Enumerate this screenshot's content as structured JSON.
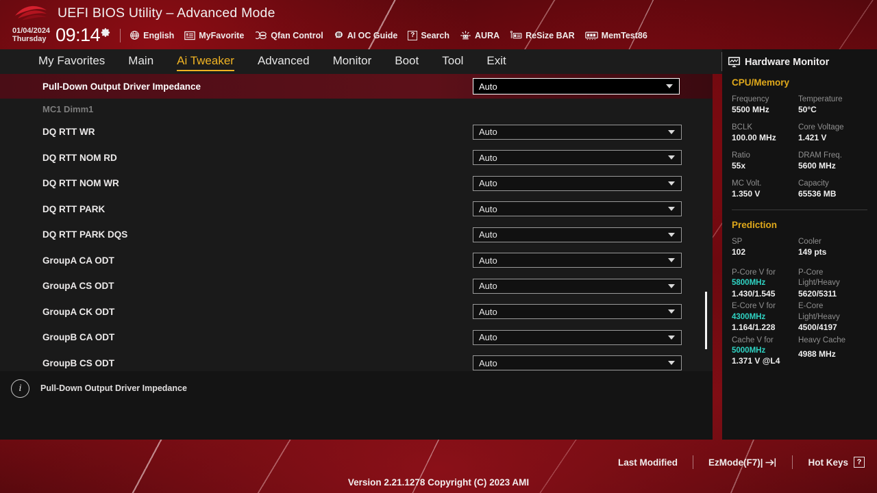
{
  "header": {
    "title": "UEFI BIOS Utility – Advanced Mode",
    "logo_icon": "rog-logo-icon",
    "date": "01/04/2024",
    "weekday": "Thursday",
    "time": "09:14",
    "gear_icon": "gear-icon",
    "tools": [
      {
        "label": "English",
        "icon": "globe-icon"
      },
      {
        "label": "MyFavorite",
        "icon": "list-icon"
      },
      {
        "label": "Qfan Control",
        "icon": "fan-icon"
      },
      {
        "label": "AI OC Guide",
        "icon": "brain-icon"
      },
      {
        "label": "Search",
        "icon": "question-box-icon"
      },
      {
        "label": "AURA",
        "icon": "aura-light-icon"
      },
      {
        "label": "ReSize BAR",
        "icon": "resize-bar-icon"
      },
      {
        "label": "MemTest86",
        "icon": "memory-module-icon"
      }
    ]
  },
  "nav": {
    "tabs": [
      {
        "label": "My Favorites",
        "active": false
      },
      {
        "label": "Main",
        "active": false
      },
      {
        "label": "Ai Tweaker",
        "active": true
      },
      {
        "label": "Advanced",
        "active": false
      },
      {
        "label": "Monitor",
        "active": false
      },
      {
        "label": "Boot",
        "active": false
      },
      {
        "label": "Tool",
        "active": false
      },
      {
        "label": "Exit",
        "active": false
      }
    ],
    "active_color": "#f0b323"
  },
  "content": {
    "selected_row": {
      "label": "Pull-Down Output Driver Impedance",
      "value": "Auto"
    },
    "section_label": "MC1 Dimm1",
    "rows": [
      {
        "label": "DQ RTT WR",
        "value": "Auto"
      },
      {
        "label": "DQ RTT NOM RD",
        "value": "Auto"
      },
      {
        "label": "DQ RTT NOM WR",
        "value": "Auto"
      },
      {
        "label": "DQ RTT PARK",
        "value": "Auto"
      },
      {
        "label": "DQ RTT PARK DQS",
        "value": "Auto"
      },
      {
        "label": "GroupA CA ODT",
        "value": "Auto"
      },
      {
        "label": "GroupA CS ODT",
        "value": "Auto"
      },
      {
        "label": "GroupA CK ODT",
        "value": "Auto"
      },
      {
        "label": "GroupB CA ODT",
        "value": "Auto"
      },
      {
        "label": "GroupB CS ODT",
        "value": "Auto"
      }
    ]
  },
  "help": {
    "icon": "info-icon",
    "text": "Pull-Down Output Driver Impedance"
  },
  "hardware_monitor": {
    "title": "Hardware Monitor",
    "title_icon": "monitor-icon",
    "sections": [
      {
        "name": "CPU/Memory",
        "color": "#e0a91b",
        "items": [
          {
            "key": "Frequency",
            "value": "5500 MHz"
          },
          {
            "key": "Temperature",
            "value": "50°C"
          },
          {
            "key": "BCLK",
            "value": "100.00 MHz"
          },
          {
            "key": "Core Voltage",
            "value": "1.421 V"
          },
          {
            "key": "Ratio",
            "value": "55x"
          },
          {
            "key": "DRAM Freq.",
            "value": "5600 MHz"
          },
          {
            "key": "MC Volt.",
            "value": "1.350 V"
          },
          {
            "key": "Capacity",
            "value": "65536 MB"
          }
        ]
      },
      {
        "name": "Prediction",
        "color": "#e0a91b",
        "items": [
          {
            "key": "SP",
            "value": "102"
          },
          {
            "key": "Cooler",
            "value": "149 pts"
          }
        ],
        "predictions": [
          {
            "key1": "P-Core V for",
            "hl1": "5800MHz",
            "val1": "1.430/1.545",
            "key2": "P-Core",
            "key2b": "Light/Heavy",
            "val2": "5620/5311"
          },
          {
            "key1": "E-Core V for",
            "hl1": "4300MHz",
            "val1": "1.164/1.228",
            "key2": "E-Core",
            "key2b": "Light/Heavy",
            "val2": "4500/4197"
          },
          {
            "key1": "Cache V for",
            "hl1": "5000MHz",
            "val1": "1.371 V @L4",
            "key2": "Heavy Cache",
            "key2b": "",
            "val2": "4988 MHz"
          }
        ],
        "highlight_color": "#2fd4c4"
      }
    ]
  },
  "footer": {
    "last_modified": "Last Modified",
    "ezmode": "EzMode(F7)|",
    "ezmode_icon": "arrow-into-box-icon",
    "hotkeys": "Hot Keys",
    "hotkeys_icon": "question-box-icon",
    "version": "Version 2.21.1278 Copyright (C) 2023 AMI"
  }
}
